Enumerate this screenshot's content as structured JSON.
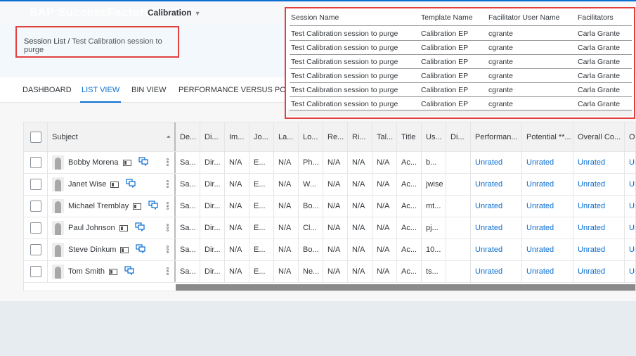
{
  "header": {
    "logo": "SAP SuccessFactors",
    "module": "Calibration",
    "module_caret": "▼"
  },
  "breadcrumb": {
    "parent": "Session List",
    "separator": " / ",
    "current": "Test Calibration session to purge"
  },
  "tabs": [
    {
      "label": "DASHBOARD"
    },
    {
      "label": "LIST VIEW",
      "active": true
    },
    {
      "label": "BIN VIEW"
    },
    {
      "label": "PERFORMANCE VERSUS POTEN"
    }
  ],
  "colors": {
    "accent": "#0a6ed1",
    "highlight_border": "#e2403f"
  },
  "table": {
    "columns": [
      "Subject",
      "De...",
      "Di...",
      "Im...",
      "Jo...",
      "La...",
      "Lo...",
      "Re...",
      "Ri...",
      "Tal...",
      "Title",
      "Us...",
      "Di...",
      "Performan...",
      "Potential **...",
      "Overall Co...",
      "Ov"
    ],
    "rows": [
      {
        "name": "Bobby Morena",
        "cells": [
          "Sa...",
          "Dir...",
          "N/A",
          "E...",
          "N/A",
          "Ph...",
          "N/A",
          "N/A",
          "N/A",
          "Ac...",
          "b...",
          "",
          "Unrated",
          "Unrated",
          "Unrated",
          "Un"
        ]
      },
      {
        "name": "Janet Wise",
        "cells": [
          "Sa...",
          "Dir...",
          "N/A",
          "E...",
          "N/A",
          "W...",
          "N/A",
          "N/A",
          "N/A",
          "Ac...",
          "jwise",
          "",
          "Unrated",
          "Unrated",
          "Unrated",
          "Un"
        ]
      },
      {
        "name": "Michael Tremblay",
        "cells": [
          "Sa...",
          "Dir...",
          "N/A",
          "E...",
          "N/A",
          "Bo...",
          "N/A",
          "N/A",
          "N/A",
          "Ac...",
          "mt...",
          "",
          "Unrated",
          "Unrated",
          "Unrated",
          "Un"
        ]
      },
      {
        "name": "Paul Johnson",
        "cells": [
          "Sa...",
          "Dir...",
          "N/A",
          "E...",
          "N/A",
          "Cl...",
          "N/A",
          "N/A",
          "N/A",
          "Ac...",
          "pj...",
          "",
          "Unrated",
          "Unrated",
          "Unrated",
          "Un"
        ]
      },
      {
        "name": "Steve Dinkum",
        "cells": [
          "Sa...",
          "Dir...",
          "N/A",
          "E...",
          "N/A",
          "Bo...",
          "N/A",
          "N/A",
          "N/A",
          "Ac...",
          "10...",
          "",
          "Unrated",
          "Unrated",
          "Unrated",
          "Un"
        ]
      },
      {
        "name": "Tom Smith",
        "cells": [
          "Sa...",
          "Dir...",
          "N/A",
          "E...",
          "N/A",
          "Ne...",
          "N/A",
          "N/A",
          "N/A",
          "Ac...",
          "ts...",
          "",
          "Unrated",
          "Unrated",
          "Unrated",
          "Un"
        ]
      }
    ]
  },
  "session_panel": {
    "columns": [
      "Session Name",
      "Template Name",
      "Facilitator User Name",
      "Facilitators"
    ],
    "rows": [
      [
        "Test Calibration session to purge",
        "Calibration EP",
        "cgrante",
        "Carla Grante"
      ],
      [
        "Test Calibration session to purge",
        "Calibration EP",
        "cgrante",
        "Carla Grante"
      ],
      [
        "Test Calibration session to purge",
        "Calibration EP",
        "cgrante",
        "Carla Grante"
      ],
      [
        "Test Calibration session to purge",
        "Calibration EP",
        "cgrante",
        "Carla Grante"
      ],
      [
        "Test Calibration session to purge",
        "Calibration EP",
        "cgrante",
        "Carla Grante"
      ],
      [
        "Test Calibration session to purge",
        "Calibration EP",
        "cgrante",
        "Carla Grante"
      ]
    ]
  }
}
